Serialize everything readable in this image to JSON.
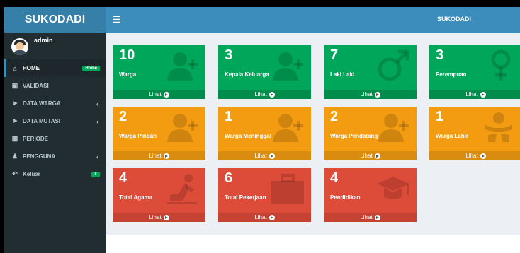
{
  "app": {
    "title": "SUKODADI",
    "topbar_title": "SUKODADI"
  },
  "user": {
    "name": "admin"
  },
  "menu": [
    {
      "label": "HOME",
      "icon": "home-icon",
      "badge": "Home",
      "active": true
    },
    {
      "label": "VALIDASI",
      "icon": "check-square-icon"
    },
    {
      "label": "DATA WARGA",
      "icon": "send-icon",
      "arrow": "‹"
    },
    {
      "label": "DATA MUTASI",
      "icon": "send-icon",
      "arrow": "‹"
    },
    {
      "label": "PERIODE",
      "icon": "table-icon"
    },
    {
      "label": "PENGGUNA",
      "icon": "user-plus-icon",
      "arrow": "‹"
    },
    {
      "label": "Keluar",
      "icon": "reply-icon",
      "badge": "X"
    }
  ],
  "boxes": [
    {
      "value": "10",
      "label": "Warga",
      "link": "Lihat",
      "color": "green",
      "icon": "user-plus-icon"
    },
    {
      "value": "3",
      "label": "Kepala Keluarga",
      "link": "Lihat",
      "color": "green",
      "icon": "user-plus-icon"
    },
    {
      "value": "7",
      "label": "Laki Laki",
      "link": "Lihat",
      "color": "green",
      "icon": "male-icon"
    },
    {
      "value": "3",
      "label": "Perempuan",
      "link": "Lihat",
      "color": "green",
      "icon": "female-icon"
    },
    {
      "value": "2",
      "label": "Warga Pindah",
      "link": "Lihat",
      "color": "orange",
      "icon": "user-plus-icon"
    },
    {
      "value": "1",
      "label": "Warga Meninggal",
      "link": "Lihat",
      "color": "orange",
      "icon": "user-plus-icon"
    },
    {
      "value": "2",
      "label": "Warga Pendatang",
      "link": "Lihat",
      "color": "orange",
      "icon": "user-plus-icon"
    },
    {
      "value": "1",
      "label": "Warga Lahir",
      "link": "Lihat",
      "color": "orange",
      "icon": "baby-icon"
    },
    {
      "value": "4",
      "label": "Total Agama",
      "link": "Lihat",
      "color": "red",
      "icon": "praying-icon"
    },
    {
      "value": "6",
      "label": "Total Pekerjaan",
      "link": "Lihat",
      "color": "red",
      "icon": "briefcase-icon"
    },
    {
      "value": "4",
      "label": "Pendidikan",
      "link": "Lihat",
      "color": "red",
      "icon": "graduation-cap-icon"
    }
  ]
}
